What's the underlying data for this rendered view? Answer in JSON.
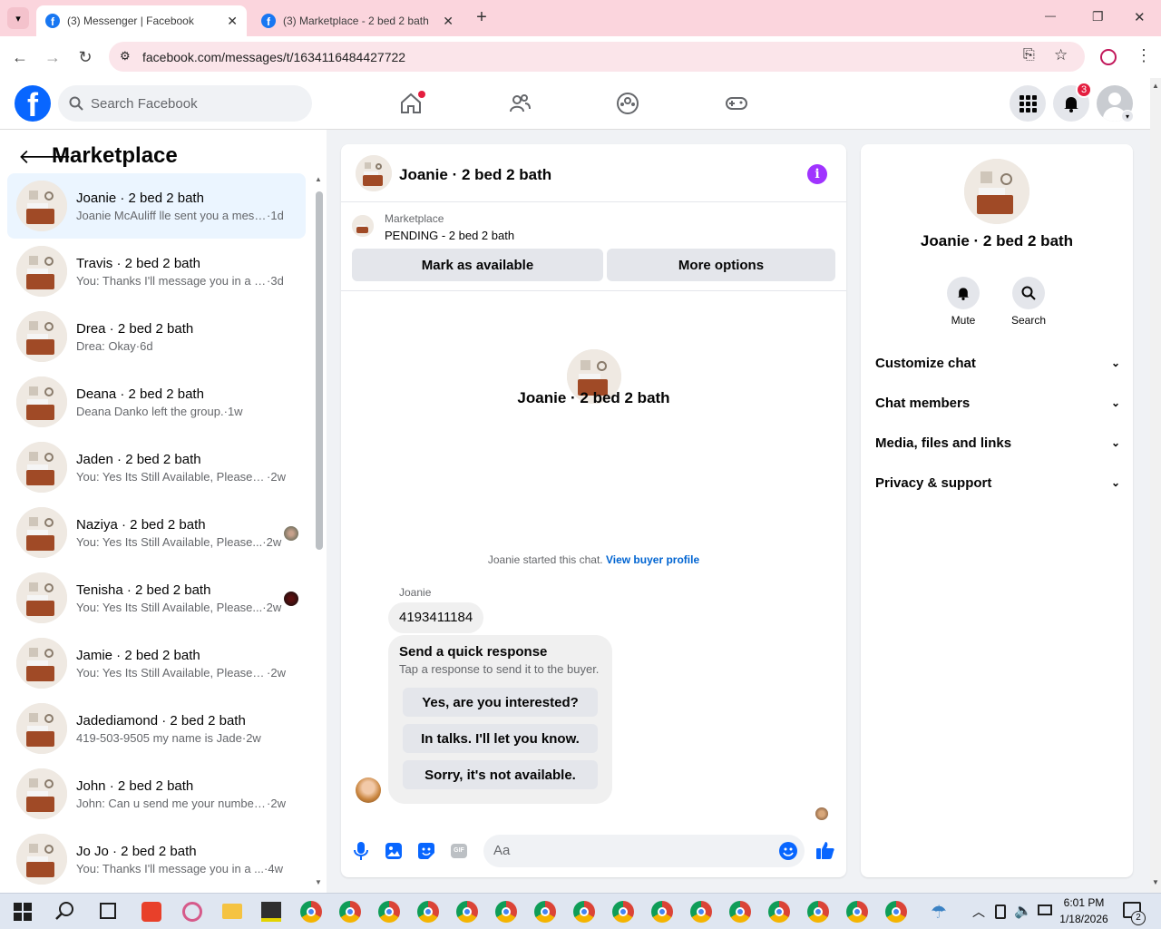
{
  "browser": {
    "tabs": [
      {
        "title": "(3) Messenger | Facebook",
        "active": true
      },
      {
        "title": "(3) Marketplace - 2 bed 2 bath",
        "active": false
      }
    ],
    "new_tab": "+",
    "url": "facebook.com/messages/t/1634116484427722",
    "window_controls": {
      "minimize": "—",
      "restore": "❐",
      "close": "✕"
    }
  },
  "fb_header": {
    "logo": "f",
    "search_placeholder": "Search Facebook",
    "notification_count": "3"
  },
  "left_panel": {
    "title": "Marketplace",
    "conversations": [
      {
        "name": "Joanie · 2 bed 2 bath",
        "snippet": "Joanie McAuliff lle sent you a mess...",
        "time": "1d",
        "active": true
      },
      {
        "name": "Travis · 2 bed 2 bath",
        "snippet": "You: Thanks I'll message you in a m...",
        "time": "3d"
      },
      {
        "name": "Drea · 2 bed 2 bath",
        "snippet": "Drea: Okay",
        "time": "6d"
      },
      {
        "name": "Deana · 2 bed 2 bath",
        "snippet": "Deana Danko left the group.",
        "time": "1w"
      },
      {
        "name": "Jaden · 2 bed 2 bath",
        "snippet": "You: Yes Its Still Available, Please Se...",
        "time": "2w"
      },
      {
        "name": "Naziya · 2 bed 2 bath",
        "snippet": "You: Yes Its Still Available, Please...",
        "time": "2w",
        "seen": "photo"
      },
      {
        "name": "Tenisha · 2 bed 2 bath",
        "snippet": "You: Yes Its Still Available, Please...",
        "time": "2w",
        "seen": "dark"
      },
      {
        "name": "Jamie · 2 bed 2 bath",
        "snippet": "You: Yes Its Still Available, Please Se...",
        "time": "2w"
      },
      {
        "name": "Jadediamond · 2 bed 2 bath",
        "snippet": "419-503-9505 my name is Jade",
        "time": "2w"
      },
      {
        "name": "John · 2 bed 2 bath",
        "snippet": "John: Can u send me your number ...",
        "time": "2w"
      },
      {
        "name": "Jo Jo · 2 bed 2 bath",
        "snippet": "You: Thanks I'll message you in a ...",
        "time": "4w"
      }
    ]
  },
  "chat": {
    "title": "Joanie · 2 bed 2 bath",
    "listing": {
      "source": "Marketplace",
      "status": "PENDING - 2 bed 2 bath"
    },
    "mark_available": "Mark as available",
    "more_options": "More options",
    "center_title": "Joanie · 2 bed 2 bath",
    "started_text": "Joanie started this chat.",
    "buyer_profile_link": "View buyer profile",
    "sender_name": "Joanie",
    "message": "4193411184",
    "quick_response": {
      "title": "Send a quick response",
      "subtitle": "Tap a response to send it to the buyer.",
      "options": [
        "Yes, are you interested?",
        "In talks. I'll let you know.",
        "Sorry, it's not available."
      ]
    },
    "composer_placeholder": "Aa",
    "gif_label": "GIF"
  },
  "info_panel": {
    "title": "Joanie · 2 bed 2 bath",
    "actions": [
      {
        "label": "Mute",
        "icon": "bell-icon"
      },
      {
        "label": "Search",
        "icon": "search-icon"
      }
    ],
    "sections": [
      "Customize chat",
      "Chat members",
      "Media, files and links",
      "Privacy & support"
    ]
  },
  "taskbar": {
    "time": "6:01 PM",
    "date": "1/18/2026",
    "notifications": "2"
  },
  "colors": {
    "fb_blue": "#0866ff",
    "accent_purple": "#a033ff",
    "tab_pink": "#fbd5dd"
  }
}
